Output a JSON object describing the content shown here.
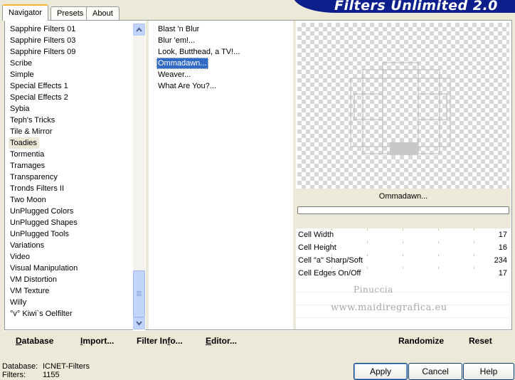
{
  "tabs": [
    "Navigator",
    "Presets",
    "About"
  ],
  "brand": {
    "title": "Filters Unlimited 2.0"
  },
  "categories": [
    "Sapphire Filters 01",
    "Sapphire Filters 03",
    "Sapphire Filters 09",
    "Scribe",
    "Simple",
    "Special Effects 1",
    "Special Effects 2",
    "Sybia",
    "Teph's Tricks",
    "Tile & Mirror",
    "Toadies",
    "Tormentia",
    "Tramages",
    "Transparency",
    "Tronds Filters II",
    "Two Moon",
    "UnPlugged Colors",
    "UnPlugged Shapes",
    "UnPlugged Tools",
    "Variations",
    "Video",
    "Visual Manipulation",
    "VM Distortion",
    "VM Texture",
    "Willy",
    "°v° Kiwi`s Oelfilter"
  ],
  "selected_category": "Toadies",
  "filters": [
    "Blast 'n Blur",
    "Blur 'em!...",
    "Look, Butthead, a TV!...",
    "Ommadawn...",
    "Weaver...",
    "What Are You?..."
  ],
  "selected_filter": "Ommadawn...",
  "preview": {
    "filter_name": "Ommadawn..."
  },
  "params": [
    {
      "label": "Cell Width",
      "value": "17"
    },
    {
      "label": "Cell Height",
      "value": "16"
    },
    {
      "label": "Cell \"a\" Sharp/Soft",
      "value": "234"
    },
    {
      "label": "Cell Edges On/Off",
      "value": "17"
    }
  ],
  "watermark": {
    "line1": "Pinuccia",
    "line2": "www.maidiregrafica.eu"
  },
  "toolbar": {
    "database": "Database",
    "import": "Import...",
    "filter_info": "Filter Info...",
    "editor": "Editor...",
    "randomize": "Randomize",
    "reset": "Reset"
  },
  "status": {
    "database_label": "Database:",
    "database_value": "ICNET-Filters",
    "filters_label": "Filters:",
    "filters_value": "1155"
  },
  "buttons": {
    "apply": "Apply",
    "cancel": "Cancel",
    "help": "Help"
  },
  "colors": {
    "banner": "#0b1e8c",
    "selection": "#316ac5",
    "accent_tab": "#f5b536"
  }
}
